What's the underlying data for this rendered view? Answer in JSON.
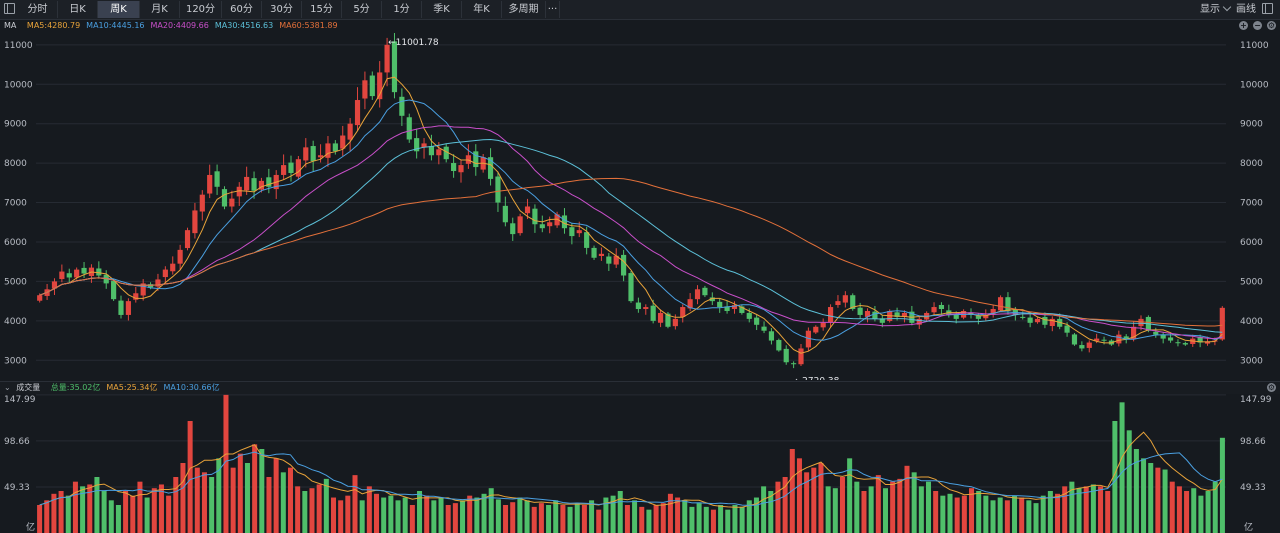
{
  "toolbar": {
    "buttons": [
      "分时",
      "日K",
      "周K",
      "月K",
      "120分",
      "60分",
      "30分",
      "15分",
      "5分",
      "1分",
      "季K",
      "年K",
      "多周期",
      "···"
    ],
    "active": "周K",
    "right_display": "显示",
    "right_draw": "画线"
  },
  "legend": {
    "ma_title": "MA",
    "ma_items": [
      {
        "text": "MA5:4280.79",
        "color": "#e8a33a"
      },
      {
        "text": "MA10:4445.16",
        "color": "#4a9fe0"
      },
      {
        "text": "MA20:4409.66",
        "color": "#c84fc9"
      },
      {
        "text": "MA30:4516.63",
        "color": "#5cc0d8"
      },
      {
        "text": "MA60:5381.89",
        "color": "#e2703a"
      }
    ],
    "vol_title": "成交量",
    "vol_items": [
      {
        "text": "总量:35.02亿",
        "color": "#4fbf6a"
      },
      {
        "text": "MA5:25.34亿",
        "color": "#e8a33a"
      },
      {
        "text": "MA10:30.66亿",
        "color": "#4a9fe0"
      }
    ]
  },
  "colors": {
    "up": "#e2463f",
    "down": "#4fbf6a",
    "grid": "#262b33",
    "bg": "#161a1f"
  },
  "icons": [
    "panel-toggle-icon",
    "chevron-down-icon",
    "plus-icon",
    "minus-icon",
    "settings-icon"
  ],
  "chart_data": [
    {
      "type": "candlestick",
      "y_ticks": [
        3000,
        4000,
        5000,
        6000,
        7000,
        8000,
        9000,
        10000,
        11000
      ],
      "ylim": [
        2500,
        11300
      ],
      "annotations": [
        {
          "label": "11001.78",
          "value": 11001.78
        },
        {
          "label": "2720.38",
          "value": 2720.38
        }
      ],
      "series": [
        {
          "name": "MA5",
          "color": "#e8a33a"
        },
        {
          "name": "MA10",
          "color": "#4a9fe0"
        },
        {
          "name": "MA20",
          "color": "#c84fc9"
        },
        {
          "name": "MA30",
          "color": "#5cc0d8"
        },
        {
          "name": "MA60",
          "color": "#e2703a"
        }
      ],
      "close": [
        4650,
        4800,
        5000,
        5250,
        5100,
        5300,
        5200,
        5350,
        5150,
        4950,
        4550,
        4150,
        4500,
        4700,
        4950,
        4850,
        5050,
        5300,
        5450,
        5800,
        6300,
        6800,
        7200,
        7700,
        7400,
        6900,
        7100,
        7400,
        7650,
        7300,
        7550,
        7400,
        7700,
        7950,
        7750,
        8100,
        8400,
        8050,
        8200,
        8500,
        8300,
        8700,
        9000,
        9600,
        10100,
        9700,
        10300,
        11000,
        9800,
        9200,
        8600,
        8300,
        8500,
        8200,
        8350,
        8100,
        7800,
        7950,
        8200,
        7900,
        8150,
        7600,
        7000,
        6500,
        6200,
        6650,
        6900,
        6450,
        6350,
        6500,
        6700,
        6350,
        6150,
        6300,
        5850,
        5600,
        5700,
        5450,
        5650,
        5150,
        4500,
        4300,
        4350,
        4000,
        4200,
        3850,
        4050,
        4350,
        4550,
        4800,
        4650,
        4500,
        4350,
        4250,
        4400,
        4200,
        4050,
        3900,
        3750,
        3500,
        3250,
        2950,
        2900,
        3300,
        3750,
        3850,
        3950,
        4350,
        4500,
        4650,
        4300,
        4150,
        4250,
        4050,
        3950,
        4250,
        4100,
        4200,
        3950,
        4050,
        4200,
        4350,
        4300,
        4150,
        4050,
        4250,
        4150,
        4050,
        4150,
        4300,
        4600,
        4250,
        4150,
        4100,
        3950,
        4050,
        3900,
        4050,
        3850,
        3700,
        3400,
        3300,
        3450,
        3550,
        3500,
        3400,
        3650,
        3550,
        3850,
        4050,
        3750,
        3650,
        3550,
        3500,
        3450,
        3400,
        3550,
        3450,
        3480,
        3500,
        4330
      ],
      "volume": [
        30,
        35,
        42,
        45,
        40,
        55,
        50,
        52,
        60,
        45,
        35,
        30,
        45,
        40,
        55,
        38,
        48,
        52,
        40,
        60,
        75,
        120,
        70,
        65,
        60,
        80,
        148,
        70,
        85,
        75,
        95,
        90,
        60,
        80,
        65,
        70,
        50,
        45,
        48,
        52,
        58,
        38,
        35,
        40,
        62,
        35,
        50,
        42,
        38,
        40,
        35,
        38,
        30,
        45,
        40,
        35,
        38,
        30,
        32,
        35,
        40,
        38,
        42,
        48,
        36,
        30,
        33,
        38,
        35,
        28,
        32,
        30,
        35,
        30,
        28,
        32,
        30,
        35,
        25,
        38,
        40,
        45,
        30,
        35,
        28,
        25,
        30,
        32,
        42,
        38,
        35,
        28,
        32,
        28,
        25,
        30,
        25,
        30,
        28,
        35,
        38,
        50,
        45,
        55,
        60,
        90,
        80,
        65,
        70,
        75,
        50,
        48,
        60,
        80,
        55,
        45,
        50,
        62,
        48,
        55,
        58,
        72,
        65,
        50,
        55,
        45,
        40,
        42,
        38,
        40,
        48,
        45,
        40,
        35,
        38,
        35,
        40,
        38,
        35,
        32,
        40,
        45,
        42,
        50,
        55,
        48,
        50,
        52,
        50,
        45,
        120,
        140,
        110,
        90,
        80,
        75,
        70,
        68,
        55,
        50,
        45,
        48,
        40,
        45,
        55,
        102
      ]
    },
    {
      "type": "bar",
      "title": "成交量",
      "y_ticks": [
        49.33,
        98.66,
        147.99
      ],
      "y_tick_labels": [
        "49.33",
        "98.66",
        "147.99"
      ],
      "unit": "亿",
      "ylim": [
        0,
        150
      ]
    }
  ]
}
